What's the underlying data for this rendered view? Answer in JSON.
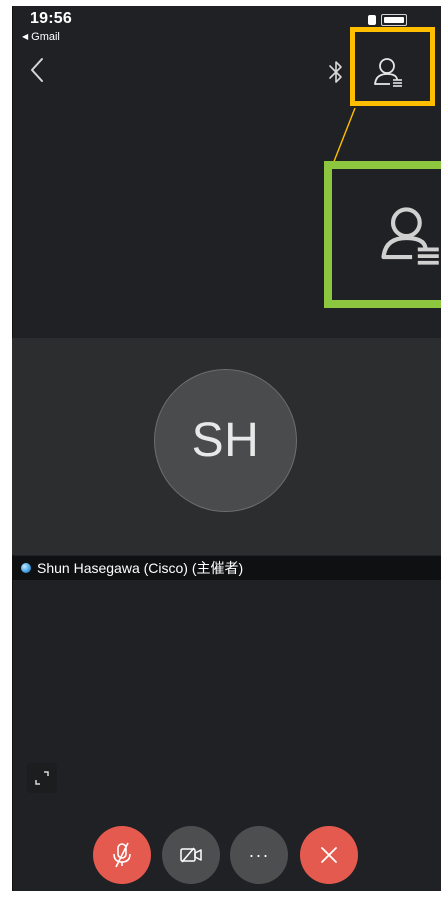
{
  "status_bar": {
    "time": "19:56",
    "back_app_label": "Gmail"
  },
  "nav": {
    "back_icon": "chevron-left-icon",
    "bluetooth_icon": "bluetooth-icon",
    "participants_icon": "participants-icon"
  },
  "annotations": {
    "highlight_color": "#ffbf00",
    "zoom_color": "#8cc63f"
  },
  "participant": {
    "initials": "SH",
    "name": "Shun Hasegawa (Cisco) (主催者)"
  },
  "controls": {
    "mute_icon": "mic-off-icon",
    "video_icon": "video-off-icon",
    "more_label": "···",
    "end_icon": "close-icon"
  },
  "colors": {
    "background": "#202124",
    "video_panel": "#2b2d2f",
    "danger": "#e55a4f",
    "neutral_button": "#4d4e50"
  }
}
